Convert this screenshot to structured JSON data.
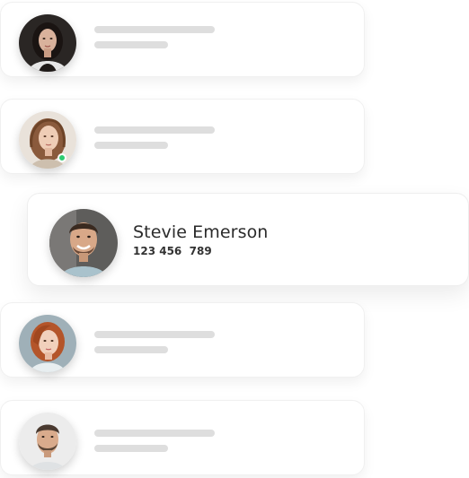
{
  "contacts": [
    {
      "avatar_icon": "woman-dark-hair-avatar-icon",
      "placeholder": true
    },
    {
      "avatar_icon": "woman-auburn-hair-avatar-icon",
      "placeholder": true,
      "online": true,
      "status_color": "#2ecc71"
    },
    {
      "avatar_icon": "man-smiling-avatar-icon",
      "placeholder": false
    },
    {
      "avatar_icon": "woman-red-hair-avatar-icon",
      "placeholder": true
    },
    {
      "avatar_icon": "man-beard-avatar-icon",
      "placeholder": true
    }
  ],
  "featured": {
    "name": "Stevie Emerson",
    "phone": "123 456  789"
  },
  "colors": {
    "placeholder_bar": "#dedede",
    "online": "#2ecc71",
    "name_text": "#2b2b2b"
  }
}
